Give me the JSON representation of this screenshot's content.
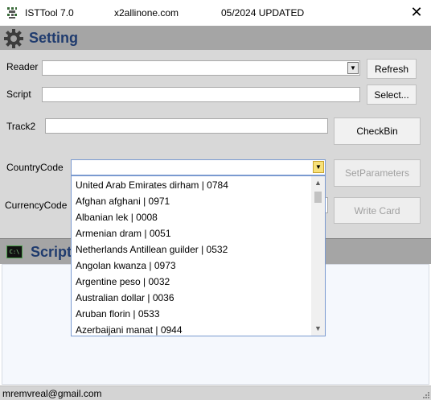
{
  "window": {
    "title": "ISTTool 7.0",
    "site": "x2allinone.com",
    "version_note": "05/2024 UPDATED",
    "close_glyph": "✕"
  },
  "setting": {
    "heading": "Setting",
    "reader_label": "Reader",
    "script_label": "Script",
    "track2_label": "Track2",
    "country_code_label": "CountryCode",
    "currency_code_label": "CurrencyCode",
    "refresh_button": "Refresh",
    "select_button": "Select...",
    "checkbin_button": "CheckBin",
    "setparameters_button": "SetParameters",
    "writecard_button": "Write Card",
    "reader_value": "",
    "script_value": "",
    "track2_value": "",
    "country_code_value": ""
  },
  "currency_dropdown": {
    "items": [
      "United Arab Emirates dirham  |  0784",
      "Afghan afghani  |  0971",
      "Albanian lek  |  0008",
      "Armenian dram  |  0051",
      "Netherlands Antillean guilder  |  0532",
      "Angolan kwanza  |  0973",
      "Argentine peso  |  0032",
      "Australian dollar  |  0036",
      "Aruban florin  |  0533",
      "Azerbaijani manat  |  0944"
    ]
  },
  "script_panel": {
    "heading": "Script",
    "icon_text": "C:\\"
  },
  "statusbar": {
    "email": "mremvreal@gmail.com"
  },
  "colors": {
    "heading_blue": "#1f3b6e",
    "section_gray": "#a5a5a5",
    "panel_gray": "#d8d8d8"
  },
  "icons": {
    "app": "app-logo-icon",
    "setting": "gear-icon",
    "script": "cmd-console-icon",
    "close": "close-icon",
    "dropdown": "chevron-down-icon"
  }
}
